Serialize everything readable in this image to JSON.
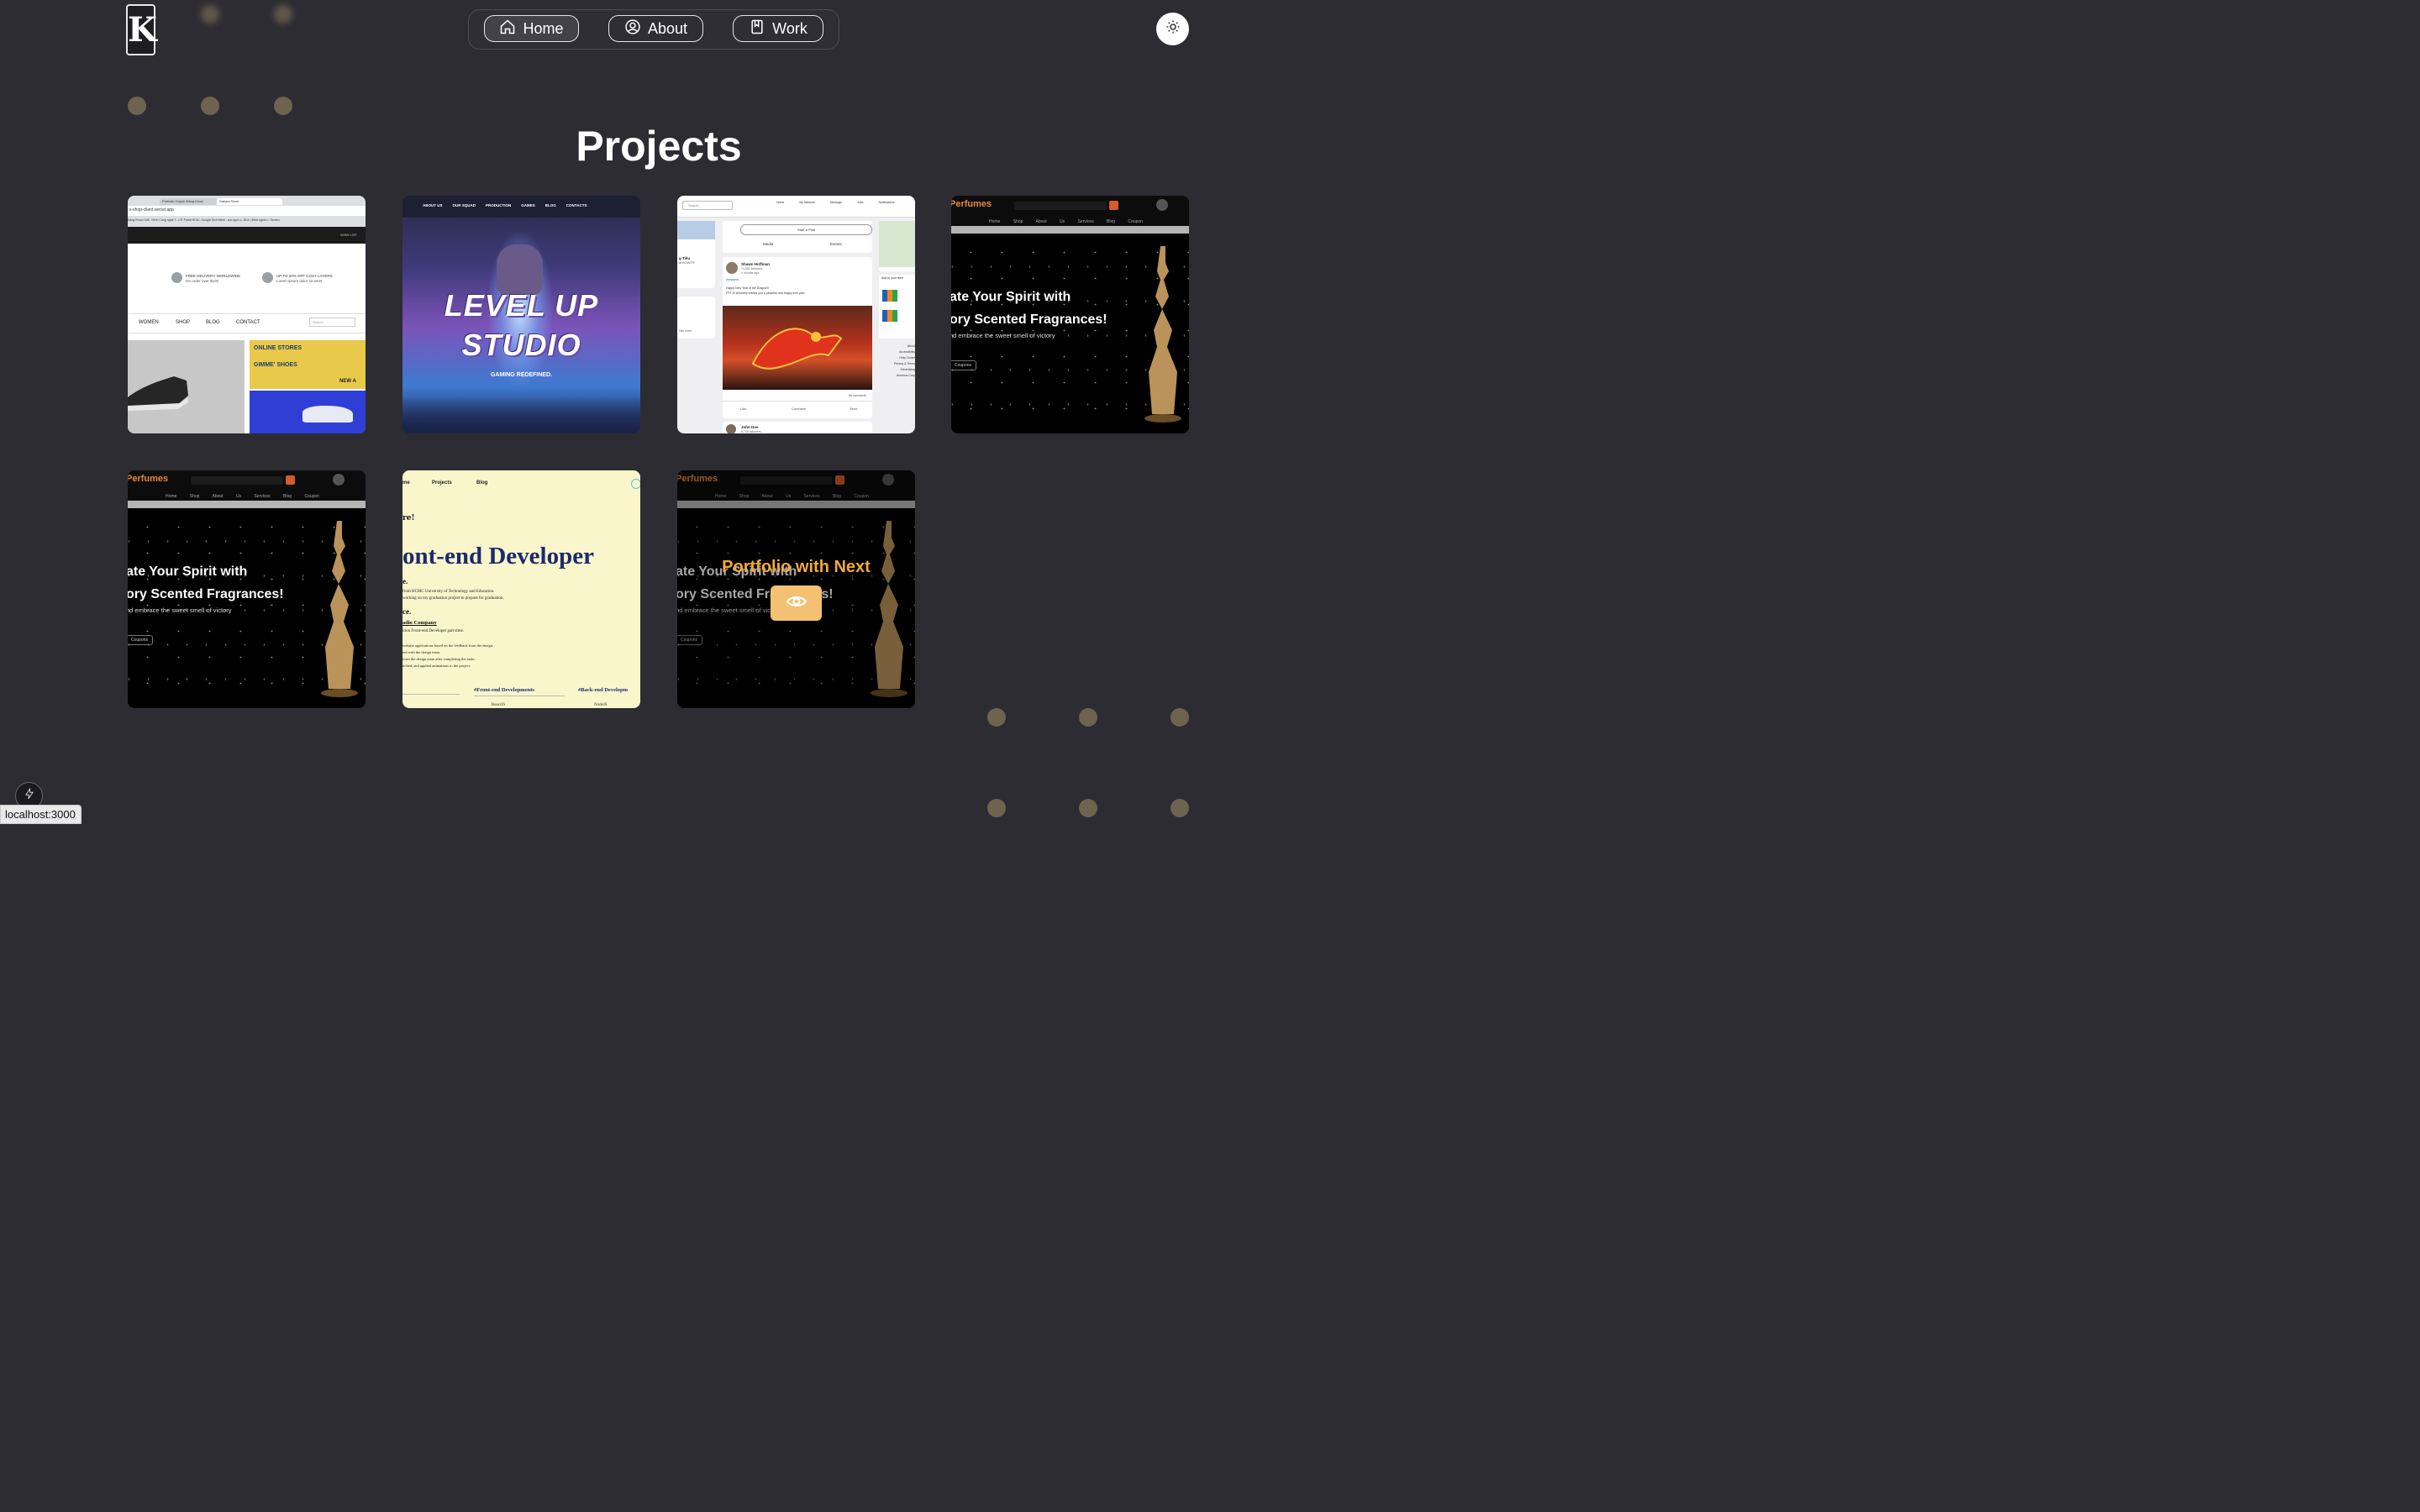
{
  "logo": {
    "letter": "K"
  },
  "nav": {
    "items": [
      {
        "label": "Home",
        "icon": "home-icon",
        "active": true
      },
      {
        "label": "About",
        "icon": "user-circle-icon",
        "active": false
      },
      {
        "label": "Work",
        "icon": "book-icon",
        "active": false
      }
    ]
  },
  "theme_toggle": {
    "icon": "sun-icon"
  },
  "page_title": "Projects",
  "projects": [
    {
      "id": "shoe-store",
      "thumb": {
        "tabs": [
          "Portfolio Huỳnh Đăng Khoa",
          "Sakara Store"
        ],
        "url": "s-shop-client.vercel.app",
        "bookmarks": "Đăng Khoa Cnlli..   Kênh Công nghệ T..   UIT Portal HCM..   Google Dịch   Meet - sun-type-o..   BLK | Blink tights t..   Screen",
        "wishlist": "WISH LIST",
        "promo1_title": "FREE DELIVERY WORLDWIDE",
        "promo1_sub": "On order over $100",
        "promo2_title": "UP TO 20% OFF COSY LAYERS",
        "promo2_sub": "Lorem ipsum dolor sit amet",
        "menu": [
          "WOMEN",
          "SHOP",
          "BLOG",
          "CONTACT"
        ],
        "search": "Search",
        "banner1": "ONLINE STORES",
        "banner2": "GIMME' SHOES",
        "banner3": "NEW A"
      }
    },
    {
      "id": "level-up-studio",
      "thumb": {
        "menu": [
          "ABOUT US",
          "OUR SQUAD",
          "PRODUCTION",
          "GAMES",
          "BLOG",
          "CONTACTS"
        ],
        "title_line1": "LEVEL UP",
        "title_line2": "STUDIO",
        "tagline": "GAMING REDEFINED."
      }
    },
    {
      "id": "social-network",
      "thumb": {
        "search": "Search",
        "nav": [
          "Home",
          "My Network",
          "Message",
          "Jobs",
          "Notifications"
        ],
        "start_post": "Start a Post",
        "media": "Media",
        "events": "Events",
        "profile_name": "g Tiêu",
        "profile_org": "at HCMUTE",
        "post_author": "Shawn Hoffman",
        "post_followers": "74,531 followers",
        "post_time": "4 months ago",
        "post_tag": "#newyear",
        "post_text1": "Happy New Year of the Dragon!!!",
        "post_text2": "FPT IS sincerely wishes you a peaceful and happy new year.",
        "comments": "86 comments",
        "actions": [
          "Like",
          "Comment",
          "Send"
        ],
        "second_author": "John Doe",
        "second_followers": "8,745 followers",
        "add_feed": "Add to your feed",
        "see_more": "See more",
        "right_links": [
          "About",
          "Accessibility",
          "Help Center",
          "Privacy & Terms",
          "Advertising",
          "Alumnus Corp"
        ]
      }
    },
    {
      "id": "perfumes-1",
      "thumb": {
        "brand": "Perfumes",
        "menu": "Home Shop About Us Services Blog Coupon",
        "headline1": "ate Your Spirit with",
        "headline2": "ory Scented Fragrances!",
        "sub": "nd embrace the sweet smell of victory",
        "button": "Coupons"
      }
    },
    {
      "id": "perfumes-2",
      "thumb": {
        "brand": "Perfumes",
        "menu": "Home Shop About Us Services Blog Coupon",
        "headline1": "ate Your Spirit with",
        "headline2": "ory Scented Fragrances!",
        "sub": "nd embrace the sweet smell of victory",
        "button": "Coupons"
      }
    },
    {
      "id": "dev-portfolio",
      "thumb": {
        "nav": [
          "me",
          "Projects",
          "Blog"
        ],
        "greeting": "re!",
        "title": "ont-end Developer",
        "line1": "e.",
        "line2": "from HCMC University of Technology and Education.",
        "line3": "working on my graduation project to prepare for graduation.",
        "exp": "ce.",
        "company": "adio Company",
        "company_role": "ition Front-end Developer part-time.",
        "bullets": [
          "website applications based on the feedback from the design.",
          "ted with the design team.",
          "from the design team after completing the tasks.",
          "ttched, and applied animations to the project."
        ],
        "sec1": "#Front-end Developments",
        "sec2": "#Back-end Developm",
        "tech1": "ReactJS",
        "tech2": "NodeJS"
      }
    },
    {
      "id": "perfumes-next",
      "overlay_title": "Portfolio with Next",
      "overlay_icon": "eye-icon",
      "thumb": {
        "brand": "Perfumes",
        "menu": "Home Shop About Us Services Blog Coupon",
        "headline1": "ate Your Spirit with",
        "headline2": "ory Scented Fragrances!",
        "sub": "nd embrace the sweet smell of victory",
        "button": "Coupons"
      }
    }
  ],
  "status_bar": {
    "url": "localhost:3000"
  },
  "dev_indicator": {
    "icon": "lightning-icon"
  }
}
